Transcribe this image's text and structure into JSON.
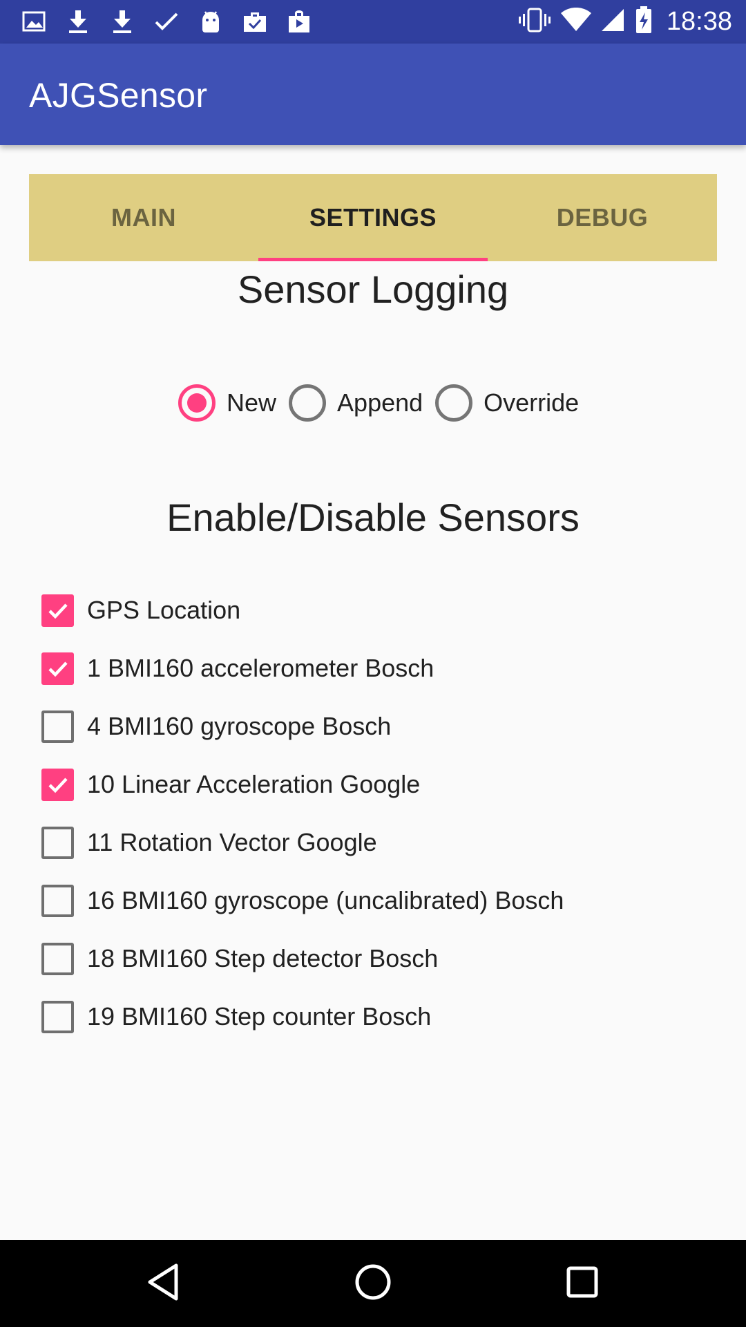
{
  "status_bar": {
    "time": "18:38",
    "left_icons": [
      "image-icon",
      "download-icon",
      "download-icon",
      "check-icon",
      "android-icon",
      "briefcase-check-icon",
      "shopping-bag-icon"
    ],
    "right_icons": [
      "vibrate-icon",
      "wifi-icon",
      "cell-signal-icon",
      "battery-charging-icon"
    ]
  },
  "app_bar": {
    "title": "AJGSensor"
  },
  "tabs": [
    {
      "label": "MAIN",
      "active": false
    },
    {
      "label": "SETTINGS",
      "active": true
    },
    {
      "label": "DEBUG",
      "active": false
    }
  ],
  "logging": {
    "heading": "Sensor Logging",
    "options": [
      {
        "label": "New",
        "checked": true
      },
      {
        "label": "Append",
        "checked": false
      },
      {
        "label": "Override",
        "checked": false
      }
    ]
  },
  "sensors": {
    "heading": "Enable/Disable Sensors",
    "items": [
      {
        "label": "GPS Location",
        "checked": true
      },
      {
        "label": "1 BMI160 accelerometer Bosch",
        "checked": true
      },
      {
        "label": "4 BMI160 gyroscope Bosch",
        "checked": false
      },
      {
        "label": "10 Linear Acceleration Google",
        "checked": true
      },
      {
        "label": "11 Rotation Vector Google",
        "checked": false
      },
      {
        "label": "16 BMI160 gyroscope (uncalibrated) Bosch",
        "checked": false
      },
      {
        "label": "18 BMI160 Step detector Bosch",
        "checked": false
      },
      {
        "label": "19 BMI160 Step counter Bosch",
        "checked": false
      }
    ]
  },
  "nav_bar": {
    "buttons": [
      "back-icon",
      "home-icon",
      "recents-icon"
    ]
  },
  "colors": {
    "primary": "#3f51b5",
    "primary_dark": "#303f9f",
    "accent": "#ff4081",
    "tab_background": "#dfce82"
  }
}
